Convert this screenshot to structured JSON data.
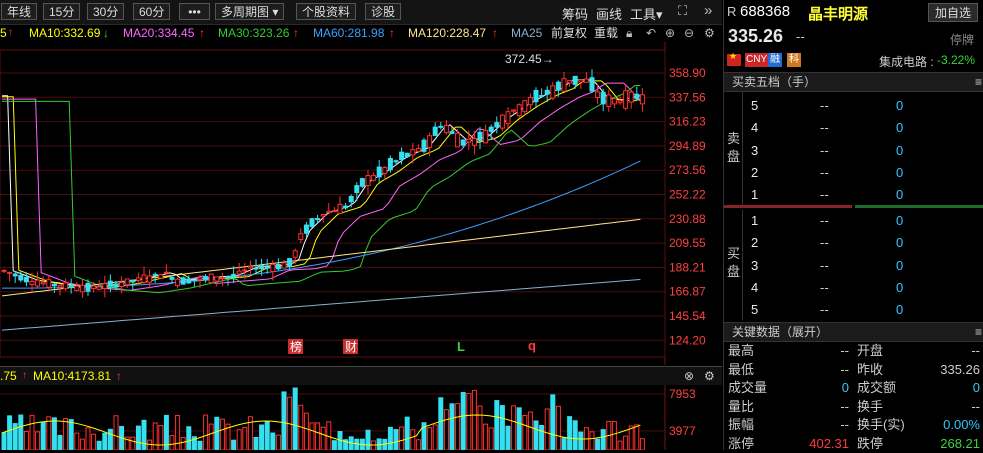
{
  "toolbar": {
    "periods": [
      "年线",
      "15分",
      "30分",
      "60分"
    ],
    "more": "•••",
    "multi_period": "多周期图",
    "stock_info": "个股资料",
    "diagnose": "诊股",
    "chips": "筹码",
    "draw": "画线",
    "tools": "工具"
  },
  "ma_line": {
    "prefix": "5",
    "ma10": "MA10:332.69",
    "ma20": "MA20:334.45",
    "ma30": "MA30:323.26",
    "ma60": "MA60:281.98",
    "ma120": "MA120:228.47",
    "ma25": "MA25",
    "adjust": "前复权",
    "overlay": "重载",
    "colors": {
      "ma10": "#ffff00",
      "ma20": "#ff66ff",
      "ma30": "#33cc33",
      "ma60": "#3aa0ff",
      "ma120": "#ffe68c",
      "ma25": "#8ab0d0"
    }
  },
  "chart": {
    "price_levels": [
      "358.90",
      "337.56",
      "316.23",
      "294.89",
      "273.56",
      "252.22",
      "230.88",
      "209.55",
      "188.21",
      "166.87",
      "145.54",
      "124.20"
    ],
    "high_label": "372.45→",
    "markers": [
      "榜",
      "财",
      "L",
      "q"
    ]
  },
  "volume": {
    "header_prefix": ".75",
    "ma10": "MA10:4173.81",
    "levels": [
      "7953",
      "3977"
    ]
  },
  "quote": {
    "badge": "R",
    "code": "688368",
    "name": "晶丰明源",
    "add_btn": "加自选",
    "price": "335.26",
    "change": "--",
    "status": "停牌",
    "tags": [
      "CNY",
      "融",
      "科"
    ],
    "sector_label": "集成电路 :",
    "sector_change": "-3.22%"
  },
  "orderbook": {
    "title": "买卖五档（手）",
    "sell_label": [
      "卖",
      "盘"
    ],
    "buy_label": [
      "买",
      "盘"
    ],
    "sell": [
      {
        "lv": "5",
        "p": "--",
        "v": "0"
      },
      {
        "lv": "4",
        "p": "--",
        "v": "0"
      },
      {
        "lv": "3",
        "p": "--",
        "v": "0"
      },
      {
        "lv": "2",
        "p": "--",
        "v": "0"
      },
      {
        "lv": "1",
        "p": "--",
        "v": "0"
      }
    ],
    "buy": [
      {
        "lv": "1",
        "p": "--",
        "v": "0"
      },
      {
        "lv": "2",
        "p": "--",
        "v": "0"
      },
      {
        "lv": "3",
        "p": "--",
        "v": "0"
      },
      {
        "lv": "4",
        "p": "--",
        "v": "0"
      },
      {
        "lv": "5",
        "p": "--",
        "v": "0"
      }
    ]
  },
  "keydata": {
    "title": "关键数据（展开）",
    "rows": [
      {
        "l1": "最高",
        "v1": "--",
        "l2": "开盘",
        "v2": "--"
      },
      {
        "l1": "最低",
        "v1": "--",
        "l2": "昨收",
        "v2": "335.26"
      },
      {
        "l1": "成交量",
        "v1": "0",
        "l2": "成交额",
        "v2": "0"
      },
      {
        "l1": "量比",
        "v1": "--",
        "l2": "换手",
        "v2": "--"
      },
      {
        "l1": "振幅",
        "v1": "--",
        "l2": "换手(实)",
        "v2": "0.00%"
      },
      {
        "l1": "涨停",
        "v1": "402.31",
        "l2": "跌停",
        "v2": "268.21"
      }
    ]
  }
}
